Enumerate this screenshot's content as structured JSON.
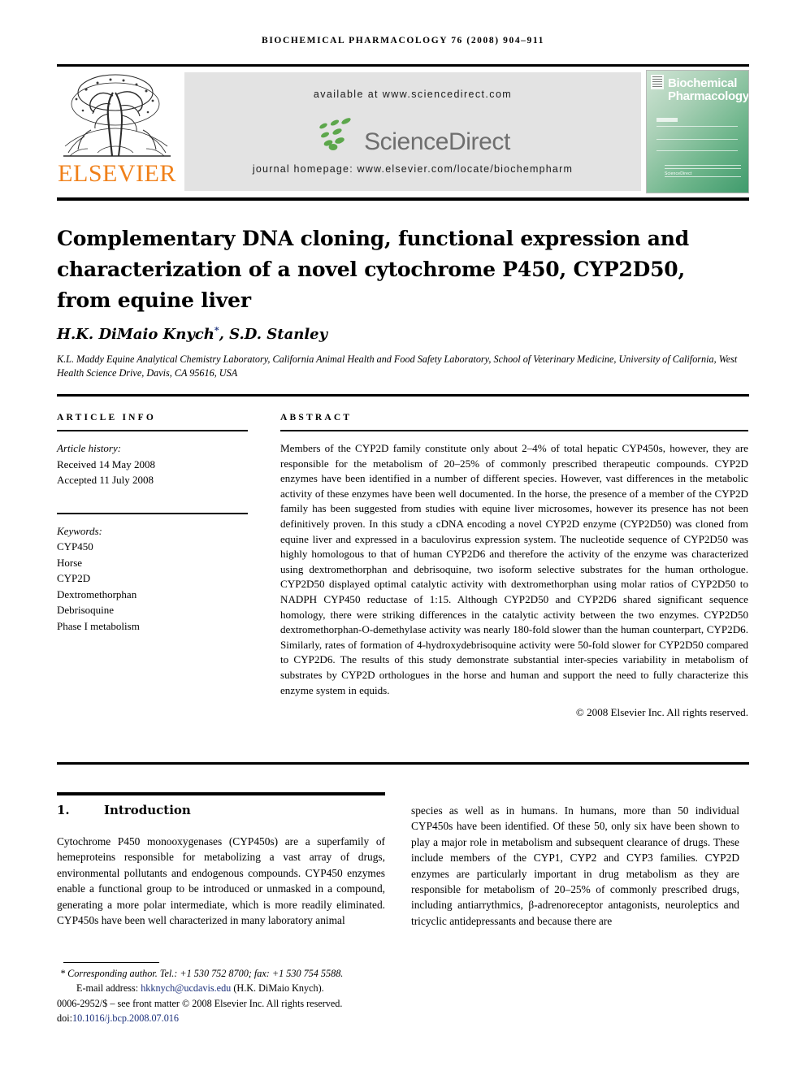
{
  "running_head": "BIOCHEMICAL PHARMACOLOGY 76 (2008) 904–911",
  "masthead": {
    "publisher": "ELSEVIER",
    "available_at": "available at www.sciencedirect.com",
    "sciencedirect_wordmark": "ScienceDirect",
    "journal_homepage": "journal homepage: www.elsevier.com/locate/biochempharm",
    "cover": {
      "title_line1": "Biochemical",
      "title_line2": "Pharmacology",
      "footer_mark": "ScienceDirect"
    }
  },
  "article": {
    "title": "Complementary DNA cloning, functional expression and characterization of a novel cytochrome P450, CYP2D50, from equine liver",
    "authors": "H.K. DiMaio Knych",
    "corresponding_marker": "*",
    "authors_rest": ", S.D. Stanley",
    "affiliation": "K.L. Maddy Equine Analytical Chemistry Laboratory, California Animal Health and Food Safety Laboratory, School of Veterinary Medicine, University of California, West Health Science Drive, Davis, CA 95616, USA"
  },
  "article_info": {
    "heading": "ARTICLE INFO",
    "history_label": "Article history:",
    "received": "Received 14 May 2008",
    "accepted": "Accepted 11 July 2008",
    "keywords_label": "Keywords:",
    "keywords": [
      "CYP450",
      "Horse",
      "CYP2D",
      "Dextromethorphan",
      "Debrisoquine",
      "Phase I metabolism"
    ]
  },
  "abstract": {
    "heading": "ABSTRACT",
    "text": "Members of the CYP2D family constitute only about 2–4% of total hepatic CYP450s, however, they are responsible for the metabolism of 20–25% of commonly prescribed therapeutic compounds. CYP2D enzymes have been identified in a number of different species. However, vast differences in the metabolic activity of these enzymes have been well documented. In the horse, the presence of a member of the CYP2D family has been suggested from studies with equine liver microsomes, however its presence has not been definitively proven. In this study a cDNA encoding a novel CYP2D enzyme (CYP2D50) was cloned from equine liver and expressed in a baculovirus expression system. The nucleotide sequence of CYP2D50 was highly homologous to that of human CYP2D6 and therefore the activity of the enzyme was characterized using dextromethorphan and debrisoquine, two isoform selective substrates for the human orthologue. CYP2D50 displayed optimal catalytic activity with dextromethorphan using molar ratios of CYP2D50 to NADPH CYP450 reductase of 1:15. Although CYP2D50 and CYP2D6 shared significant sequence homology, there were striking differences in the catalytic activity between the two enzymes. CYP2D50 dextromethorphan-O-demethylase activity was nearly 180-fold slower than the human counterpart, CYP2D6. Similarly, rates of formation of 4-hydroxydebrisoquine activity were 50-fold slower for CYP2D50 compared to CYP2D6. The results of this study demonstrate substantial inter-species variability in metabolism of substrates by CYP2D orthologues in the horse and human and support the need to fully characterize this enzyme system in equids.",
    "copyright": "© 2008 Elsevier Inc. All rights reserved."
  },
  "introduction": {
    "number": "1.",
    "heading": "Introduction",
    "column_left": "Cytochrome P450 monooxygenases (CYP450s) are a superfamily of hemeproteins responsible for metabolizing a vast array of drugs, environmental pollutants and endogenous compounds. CYP450 enzymes enable a functional group to be introduced or unmasked in a compound, generating a more polar intermediate, which is more readily eliminated. CYP450s have been well characterized in many laboratory animal",
    "column_right": "species as well as in humans. In humans, more than 50 individual CYP450s have been identified. Of these 50, only six have been shown to play a major role in metabolism and subsequent clearance of drugs. These include members of the CYP1, CYP2 and CYP3 families. CYP2D enzymes are particularly important in drug metabolism as they are responsible for metabolism of 20–25% of commonly prescribed drugs, including antiarrythmics, β-adrenoreceptor antagonists, neuroleptics and tricyclic antidepressants and because there are"
  },
  "footnotes": {
    "corresponding": "* Corresponding author. Tel.: +1 530 752 8700; fax: +1 530 754 5588.",
    "email_label": "E-mail address:",
    "email": "hkknych@ucdavis.edu",
    "email_suffix": "(H.K. DiMaio Knych).",
    "front_matter": "0006-2952/$ – see front matter © 2008 Elsevier Inc. All rights reserved.",
    "doi_label": "doi:",
    "doi": "10.1016/j.bcp.2008.07.016"
  },
  "colors": {
    "elsevier_orange": "#F08019",
    "sciencedirect_green": "#5CA74B",
    "link_blue": "#1a2f7a",
    "banner_gray": "#E3E3E3"
  }
}
